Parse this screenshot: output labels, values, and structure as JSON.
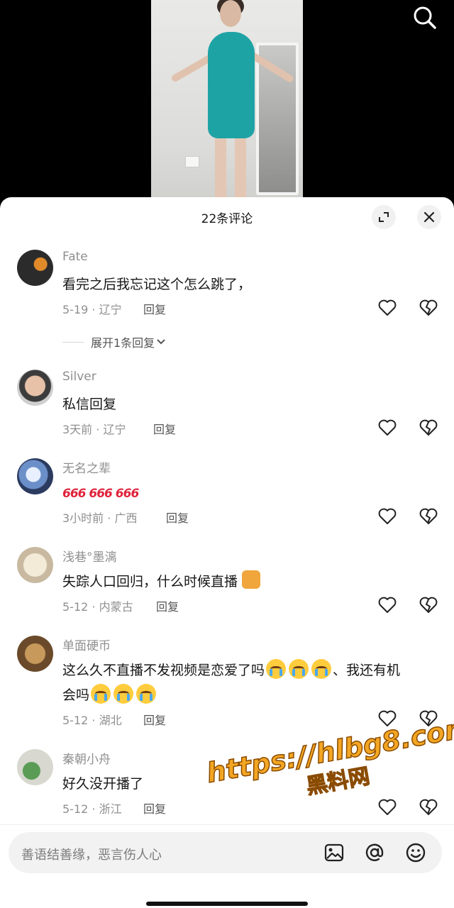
{
  "video": {
    "icons": [
      "search-icon"
    ]
  },
  "sheet": {
    "title": "22条评论",
    "icons": [
      "expand-icon",
      "close-icon"
    ]
  },
  "comments": [
    {
      "name": "Fate",
      "text": "看完之后我忘记这个怎么跳了，",
      "meta": "5-19 · 辽宁",
      "reply": "回复",
      "expand": "展开1条回复"
    },
    {
      "name": "Silver",
      "text": "私信回复",
      "meta": "3天前 · 辽宁",
      "reply": "回复"
    },
    {
      "name": "无名之辈",
      "text": "666 666 666",
      "meta": "3小时前 · 广西",
      "reply": "回复"
    },
    {
      "name": "浅巷°墨漓",
      "text": "失踪人口回归，什么时候直播",
      "meta": "5-12 · 内蒙古",
      "reply": "回复"
    },
    {
      "name": "单面硬币",
      "text_a": "这么久不直播不发视频是恋爱了吗",
      "text_b": "、我还有机",
      "text_c": "会吗",
      "meta": "5-12 · 湖北",
      "reply": "回复"
    },
    {
      "name": "秦朝小舟",
      "text": "好久没开播了",
      "meta": "5-12 · 浙江",
      "reply": "回复"
    }
  ],
  "watermark": {
    "url": "https://hlbg8.com",
    "cn": "黑料网"
  },
  "input": {
    "placeholder": "善语结善缘，恶言伤人心",
    "icons": [
      "image-icon",
      "at-icon",
      "emoji-icon"
    ]
  },
  "colors": {
    "like": "#222222",
    "meta": "#8f8f8f",
    "watermark": "#f3a623"
  }
}
